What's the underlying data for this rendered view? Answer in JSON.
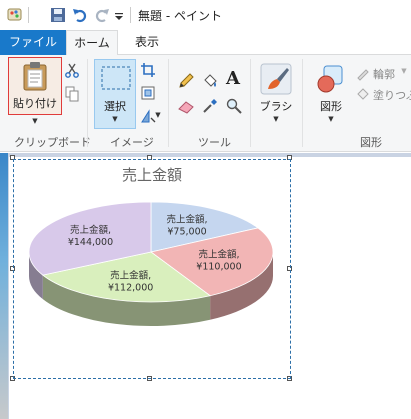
{
  "window": {
    "title": "無題 - ペイント"
  },
  "ribbon_tabs": [
    {
      "label": "ファイル"
    },
    {
      "label": "ホーム"
    },
    {
      "label": "表示"
    }
  ],
  "groups": {
    "clipboard": {
      "label": "クリップボード",
      "paste_label": "貼り付け"
    },
    "image": {
      "label": "イメージ",
      "select_label": "選択"
    },
    "tools": {
      "label": "ツール"
    },
    "brush": {
      "label": "ブラシ"
    },
    "shapes": {
      "label": "図形",
      "shapes_label": "図形",
      "outline_label": "輪郭",
      "fill_label": "塗りつぶ"
    }
  },
  "chart_data": {
    "type": "pie",
    "title": "売上金額",
    "slices": [
      {
        "label": "売上金額,",
        "value_text": "¥75,000",
        "value": 75000,
        "color": "#c5d6ef"
      },
      {
        "label": "売上金額,",
        "value_text": "¥110,000",
        "value": 110000,
        "color": "#f2b5b5"
      },
      {
        "label": "売上金額,",
        "value_text": "¥112,000",
        "value": 112000,
        "color": "#d9efbd"
      },
      {
        "label": "売上金額,",
        "value_text": "¥144,000",
        "value": 144000,
        "color": "#d8c9ea"
      }
    ]
  }
}
